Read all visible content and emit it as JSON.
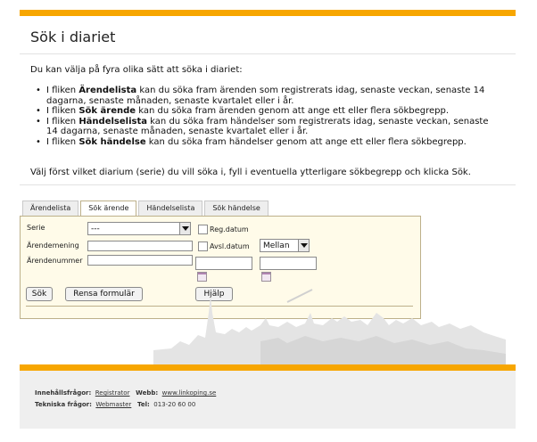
{
  "page": {
    "title": "Sök i diariet",
    "intro": "Du kan välja på fyra olika sätt att söka i diariet:",
    "methods": [
      {
        "pre": "I fliken ",
        "bold": "Ärendelista",
        "post": " kan du söka fram ärenden som registrerats idag, senaste veckan, senaste 14 dagarna, senaste månaden, senaste kvartalet eller i år."
      },
      {
        "pre": "I fliken ",
        "bold": "Sök ärende",
        "post": " kan du söka fram ärenden genom att ange ett eller flera sökbegrepp."
      },
      {
        "pre": "I fliken ",
        "bold": "Händelselista",
        "post": " kan du söka fram händelser som registrerats idag, senaste veckan, senaste 14 dagarna, senaste månaden, senaste kvartalet eller i år."
      },
      {
        "pre": "I fliken ",
        "bold": "Sök händelse",
        "post": " kan du söka fram händelser genom att ange ett eller flera sökbegrepp."
      }
    ],
    "outro": "Välj först vilket diarium (serie) du vill söka i, fyll i eventuella ytterligare sökbegrepp och klicka Sök."
  },
  "tabs": [
    "Ärendelista",
    "Sök ärende",
    "Händelselista",
    "Sök händelse"
  ],
  "active_tab": "Sök ärende",
  "form": {
    "serie_label": "Serie",
    "serie_value": "---",
    "arendemening_label": "Ärendemening",
    "arendemening_value": "",
    "arendenummer_label": "Ärendenummer",
    "arendenummer_value": "",
    "reg_datum_label": "Reg.datum",
    "reg_datum_checked": false,
    "avsl_datum_label": "Avsl.datum",
    "avsl_datum_checked": false,
    "range_value": "Mellan",
    "date_from_value": "",
    "date_to_value": "",
    "search_button": "Sök",
    "reset_button": "Rensa formulär",
    "help_button": "Hjälp"
  },
  "footer": {
    "content_q_label": "Innehållsfrågor:",
    "content_q_link": "Registrator",
    "web_label": "Webb:",
    "web_link": "www.linkoping.se",
    "tech_q_label": "Tekniska frågor:",
    "tech_q_link": "Webmaster",
    "tel_label": "Tel:",
    "tel_value": "013-20 60 00"
  },
  "colors": {
    "accent": "#f7a600",
    "panel_bg": "#fffbe9",
    "footer_bg": "#efefef"
  }
}
